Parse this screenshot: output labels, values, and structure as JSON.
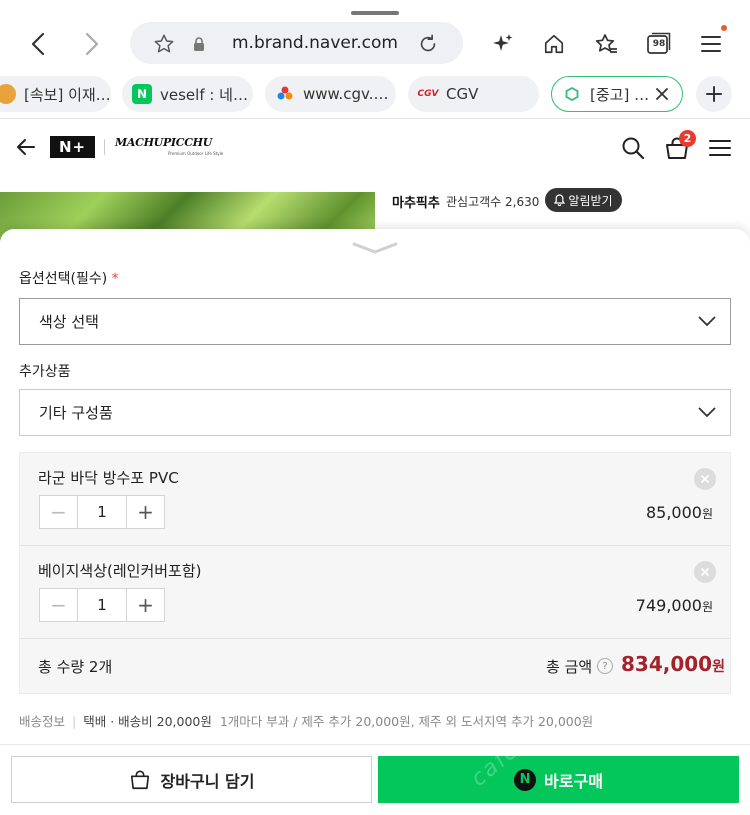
{
  "browser": {
    "url": "m.brand.naver.com",
    "tab_count": "98",
    "tabs": [
      {
        "label": "[속보] 이재…",
        "icon_color": "#e8a33a"
      },
      {
        "label": "veself : 네…",
        "icon_letter": "N",
        "icon_color": "#03c75a"
      },
      {
        "label": "www.cgv.…",
        "icon_color": "#c0392b"
      },
      {
        "label": "CGV",
        "icon_letter": "CGV",
        "icon_color": "#d0232a"
      },
      {
        "label": "[중고] …",
        "icon_color": "#2fbf71"
      }
    ]
  },
  "site": {
    "logo_badge": "N+",
    "brand_logo": "MACHUPICCHU",
    "brand_tagline": "Premium Outdoor Life Style",
    "cart_count": "2"
  },
  "store": {
    "name": "마추픽추",
    "fans_label": "관심고객수 2,630",
    "notify_label": "알림받기"
  },
  "sheet": {
    "option_label": "옵션선택(필수)",
    "required_mark": "*",
    "option_select": "색상 선택",
    "addon_label": "추가상품",
    "addon_select": "기타 구성품",
    "items": [
      {
        "name": "라군 바닥 방수포 PVC",
        "qty": "1",
        "price": "85,000",
        "unit": "원"
      },
      {
        "name": "베이지색상(레인커버포함)",
        "qty": "1",
        "price": "749,000",
        "unit": "원"
      }
    ],
    "total_qty": "총 수량 2개",
    "total_label": "총 금액",
    "total_help": "?",
    "total_amount": "834,000",
    "total_unit": "원",
    "shipping_label": "배송정보",
    "shipping_value": "택배 · 배송비 20,000원",
    "shipping_note": "1개마다 부과 / 제주 추가 20,000원, 제주 외 도서지역 추가 20,000원"
  },
  "footer": {
    "cart_button": "장바구니 담기",
    "buy_icon": "N",
    "buy_button": "바로구매",
    "watermark": "cafe"
  },
  "colors": {
    "accent_green": "#03c75a",
    "price_red": "#a3232d",
    "badge_red": "#e83a2f"
  }
}
